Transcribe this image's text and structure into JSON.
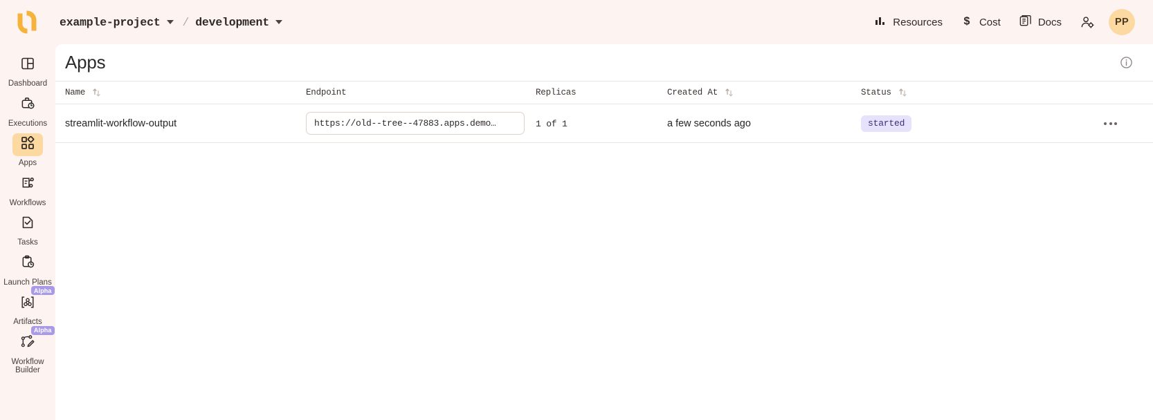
{
  "topbar": {
    "logo_name": "union-logo",
    "breadcrumb": {
      "project": "example-project",
      "separator": "/",
      "domain": "development"
    },
    "nav": [
      {
        "label": "Resources",
        "icon": "bar-chart-icon"
      },
      {
        "label": "Cost",
        "icon": "dollar-sign-icon"
      },
      {
        "label": "Docs",
        "icon": "document-icon"
      }
    ],
    "user_settings_icon": "user-gear-icon",
    "avatar_initials": "PP",
    "avatar_color": "#fcd9a0"
  },
  "sidebar": {
    "items": [
      {
        "label": "Dashboard",
        "icon": "layout-dashboard-icon",
        "active": false,
        "badge": ""
      },
      {
        "label": "Executions",
        "icon": "briefcase-clock-icon",
        "active": false,
        "badge": ""
      },
      {
        "label": "Apps",
        "icon": "apps-grid-icon",
        "active": true,
        "badge": ""
      },
      {
        "label": "Workflows",
        "icon": "workflow-nodes-icon",
        "active": false,
        "badge": ""
      },
      {
        "label": "Tasks",
        "icon": "file-check-icon",
        "active": false,
        "badge": ""
      },
      {
        "label": "Launch Plans",
        "icon": "clipboard-clock-icon",
        "active": false,
        "badge": ""
      },
      {
        "label": "Artifacts",
        "icon": "artifact-molecule-icon",
        "active": false,
        "badge": "Alpha"
      },
      {
        "label": "Workflow Builder",
        "icon": "graph-pencil-icon",
        "active": false,
        "badge": "Alpha"
      }
    ]
  },
  "page": {
    "title": "Apps",
    "info_icon": "info-circle-icon"
  },
  "table": {
    "columns": [
      {
        "key": "name",
        "label": "Name",
        "sortable": true
      },
      {
        "key": "endpoint",
        "label": "Endpoint",
        "sortable": false
      },
      {
        "key": "replicas",
        "label": "Replicas",
        "sortable": false
      },
      {
        "key": "created_at",
        "label": "Created At",
        "sortable": true
      },
      {
        "key": "status",
        "label": "Status",
        "sortable": true
      }
    ],
    "rows": [
      {
        "name": "streamlit-workflow-output",
        "endpoint": "https://old--tree--47883.apps.demo…",
        "replicas": "1 of 1",
        "created_at": "a few seconds ago",
        "status": "started",
        "status_bg": "#e7e2fb",
        "status_fg": "#3b2f7a",
        "actions_icon": "kebab-menu-icon"
      }
    ]
  },
  "theme": {
    "chrome_bg": "#fdf3f0",
    "accent": "#f5b33c",
    "active_nav_bg": "#fcd9a0"
  }
}
